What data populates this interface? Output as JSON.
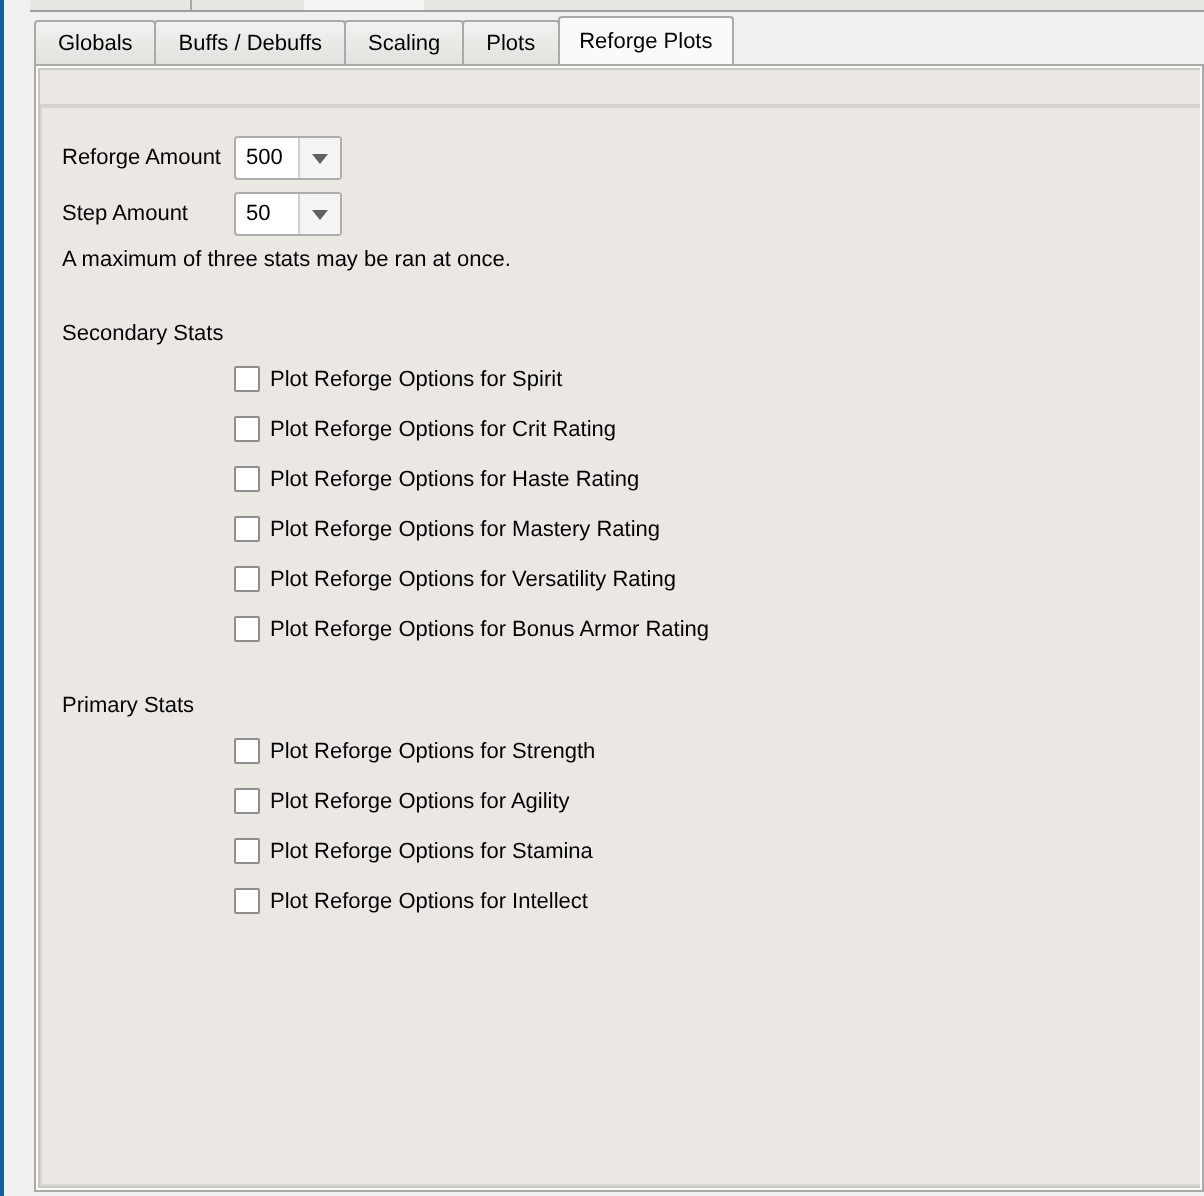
{
  "tabs": [
    {
      "label": "Globals",
      "selected": false
    },
    {
      "label": "Buffs / Debuffs",
      "selected": false
    },
    {
      "label": "Scaling",
      "selected": false
    },
    {
      "label": "Plots",
      "selected": false
    },
    {
      "label": "Reforge Plots",
      "selected": true
    }
  ],
  "settings": [
    {
      "label": "Reforge Amount",
      "value": "500"
    },
    {
      "label": "Step Amount",
      "value": "50"
    }
  ],
  "note": "A maximum of three stats may be ran at once.",
  "groups": [
    {
      "title": "Secondary Stats",
      "options": [
        {
          "label": "Plot Reforge Options for Spirit",
          "checked": false
        },
        {
          "label": "Plot Reforge Options for Crit Rating",
          "checked": false
        },
        {
          "label": "Plot Reforge Options for Haste Rating",
          "checked": false
        },
        {
          "label": "Plot Reforge Options for Mastery Rating",
          "checked": false
        },
        {
          "label": "Plot Reforge Options for Versatility Rating",
          "checked": false
        },
        {
          "label": "Plot Reforge Options for Bonus Armor Rating",
          "checked": false
        }
      ]
    },
    {
      "title": "Primary Stats",
      "options": [
        {
          "label": "Plot Reforge Options for Strength",
          "checked": false
        },
        {
          "label": "Plot Reforge Options for Agility",
          "checked": false
        },
        {
          "label": "Plot Reforge Options for Stamina",
          "checked": false
        },
        {
          "label": "Plot Reforge Options for Intellect",
          "checked": false
        }
      ]
    }
  ]
}
